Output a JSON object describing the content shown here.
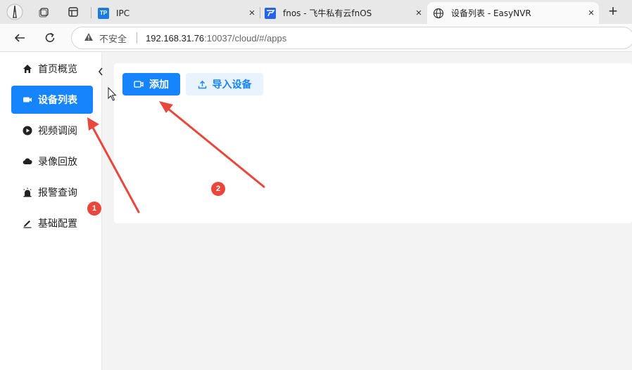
{
  "browser": {
    "tabs": [
      {
        "title": "IPC",
        "icon": "tp-link-favicon",
        "active": false
      },
      {
        "title": "fnos - 飞牛私有云fnOS",
        "icon": "fnos-favicon",
        "active": false
      },
      {
        "title": "设备列表 - EasyNVR",
        "icon": "globe-icon",
        "active": true
      }
    ],
    "address": {
      "security_label": "不安全",
      "host": "192.168.31.76",
      "rest": ":10037/cloud/#/apps"
    }
  },
  "sidebar": {
    "items": [
      {
        "label": "首页概览",
        "icon": "home-icon",
        "active": false
      },
      {
        "label": "设备列表",
        "icon": "camera-icon",
        "active": true
      },
      {
        "label": "视频调阅",
        "icon": "play-icon",
        "active": false
      },
      {
        "label": "录像回放",
        "icon": "cloud-icon",
        "active": false
      },
      {
        "label": "报警查询",
        "icon": "alarm-icon",
        "active": false
      },
      {
        "label": "基础配置",
        "icon": "edit-icon",
        "active": false
      }
    ]
  },
  "toolbar": {
    "add_label": "添加",
    "import_label": "导入设备"
  },
  "annotations": {
    "badge_1": "1",
    "badge_2": "2"
  },
  "colors": {
    "accent": "#1684fc",
    "annotation": "#e8473e"
  }
}
